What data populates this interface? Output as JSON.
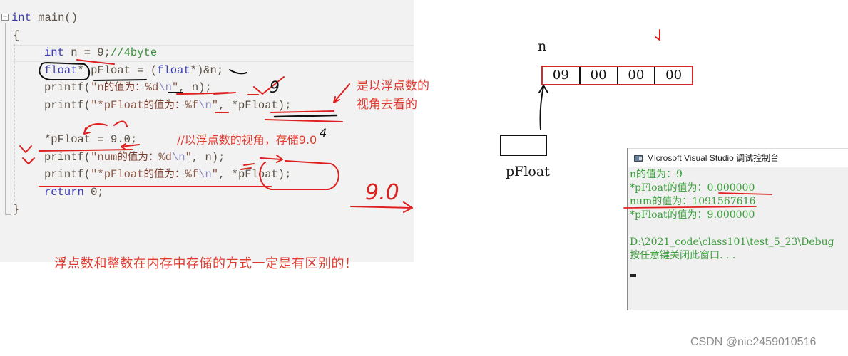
{
  "editor": {
    "lines": [
      {
        "id": "main-signature",
        "tokens": [
          {
            "t": "kw",
            "v": "int"
          },
          {
            "t": "plain",
            "v": " main()"
          }
        ]
      },
      {
        "id": "open-brace",
        "tokens": [
          {
            "t": "plain",
            "v": "{"
          }
        ]
      },
      {
        "id": "decl-n",
        "tokens": [
          {
            "t": "kw",
            "v": "int"
          },
          {
            "t": "plain",
            "v": " n = 9;"
          },
          {
            "t": "cmt",
            "v": "//4byte"
          }
        ]
      },
      {
        "id": "decl-pfloat",
        "tokens": [
          {
            "t": "kw",
            "v": "float"
          },
          {
            "t": "plain",
            "v": "* pFloat = ("
          },
          {
            "t": "kw",
            "v": "float"
          },
          {
            "t": "plain",
            "v": "*)&n;"
          }
        ]
      },
      {
        "id": "printf-n",
        "tokens": [
          {
            "t": "plain",
            "v": "printf("
          },
          {
            "t": "str",
            "v": "\"n"
          },
          {
            "t": "cjk",
            "v": "的值为："
          },
          {
            "t": "str",
            "v": "%d"
          },
          {
            "t": "esc",
            "v": "\\n"
          },
          {
            "t": "str",
            "v": "\""
          },
          {
            "t": "plain",
            "v": ", n);"
          }
        ]
      },
      {
        "id": "printf-pfloat-1",
        "tokens": [
          {
            "t": "plain",
            "v": "printf("
          },
          {
            "t": "str",
            "v": "\"*pFloat"
          },
          {
            "t": "cjk",
            "v": "的值为："
          },
          {
            "t": "str",
            "v": "%f"
          },
          {
            "t": "esc",
            "v": "\\n"
          },
          {
            "t": "str",
            "v": "\""
          },
          {
            "t": "plain",
            "v": ", *pFloat);"
          }
        ]
      },
      {
        "id": "blank",
        "tokens": []
      },
      {
        "id": "assign-pfloat",
        "tokens": [
          {
            "t": "plain",
            "v": "*pFloat = 9.0;"
          }
        ]
      },
      {
        "id": "printf-num",
        "tokens": [
          {
            "t": "plain",
            "v": "printf("
          },
          {
            "t": "str",
            "v": "\"num"
          },
          {
            "t": "cjk",
            "v": "的值为："
          },
          {
            "t": "str",
            "v": "%d"
          },
          {
            "t": "esc",
            "v": "\\n"
          },
          {
            "t": "str",
            "v": "\""
          },
          {
            "t": "plain",
            "v": ", n);"
          }
        ]
      },
      {
        "id": "printf-pfloat-2",
        "tokens": [
          {
            "t": "plain",
            "v": "printf("
          },
          {
            "t": "str",
            "v": "\"*pFloat"
          },
          {
            "t": "cjk",
            "v": "的值为："
          },
          {
            "t": "str",
            "v": "%f"
          },
          {
            "t": "esc",
            "v": "\\n"
          },
          {
            "t": "str",
            "v": "\""
          },
          {
            "t": "plain",
            "v": ", *pFloat);"
          }
        ]
      },
      {
        "id": "return",
        "tokens": [
          {
            "t": "kw",
            "v": "return"
          },
          {
            "t": "plain",
            "v": " 0;"
          }
        ]
      },
      {
        "id": "close-brace",
        "tokens": [
          {
            "t": "plain",
            "v": "}"
          }
        ]
      }
    ],
    "fold_glyph": "−"
  },
  "notes": {
    "float_view_line1": "是以浮点数的",
    "float_view_line2": "视角去看的",
    "store_comment": "//以浮点数的视角，存储9.0",
    "conclusion": "浮点数和整数在内存中存储的方式一定是有区别的！",
    "handwritten_9": "9",
    "handwritten_4": "4",
    "handwritten_9_0": "9.0"
  },
  "diagram": {
    "var_label": "n",
    "bytes": [
      "09",
      "00",
      "00",
      "00"
    ],
    "pointer_label": "pFloat",
    "highlight_color": "#d42a2a"
  },
  "console": {
    "title": "Microsoft Visual Studio 调试控制台",
    "output_lines": [
      "n的值为：9",
      "*pFloat的值为：0.000000",
      "num的值为：1091567616",
      "*pFloat的值为：9.000000",
      "",
      "D:\\2021_code\\class101\\test_5_23\\Debug",
      "按任意键关闭此窗口. . ."
    ],
    "text_color": "#3aa03a"
  },
  "watermark": "CSDN @nie2459010516"
}
